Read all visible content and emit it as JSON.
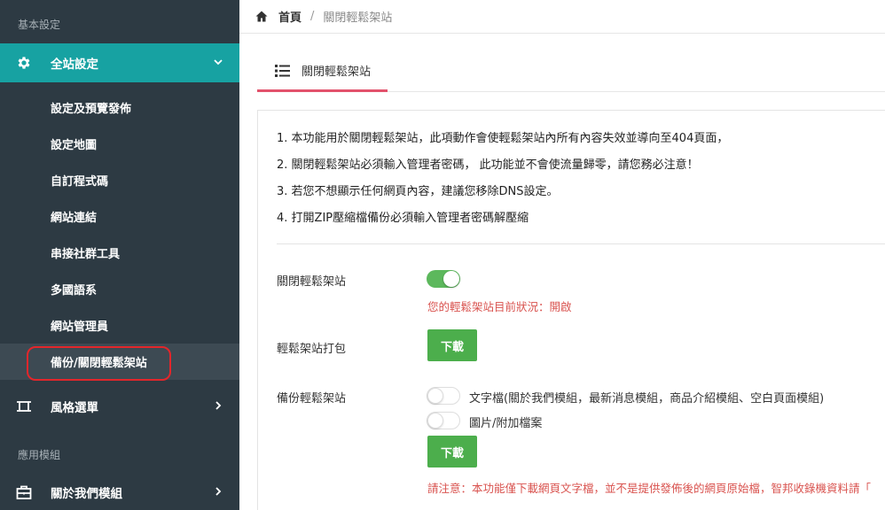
{
  "sidebar": {
    "section_basic": "基本設定",
    "group_site": {
      "label": "全站設定",
      "icon": "gear-icon"
    },
    "sub_items": [
      "設定及預覽發佈",
      "設定地圖",
      "自訂程式碼",
      "網站連結",
      "串接社群工具",
      "多國語系",
      "網站管理員",
      "備份/關閉輕鬆架站"
    ],
    "group_style": {
      "label": "風格選單",
      "icon": "crop-frame-icon"
    },
    "section_modules": "應用模組",
    "group_about": {
      "label": "關於我們模組",
      "icon": "briefcase-icon"
    }
  },
  "breadcrumb": {
    "home": "首頁",
    "separator": "/",
    "current": "關閉輕鬆架站"
  },
  "tab": {
    "label": "關閉輕鬆架站"
  },
  "notes": [
    "1. 本功能用於關閉輕鬆架站，此項動作會使輕鬆架站內所有內容失效並導向至404頁面，",
    "2. 關閉輕鬆架站必須輸入管理者密碼， 此功能並不會使流量歸零，請您務必注意！",
    "3. 若您不想顯示任何網頁內容，建議您移除DNS設定。",
    "4. 打開ZIP壓縮檔備份必須輸入管理者密碼解壓縮"
  ],
  "close_site": {
    "label": "關閉輕鬆架站",
    "toggle_on": true,
    "status": "您的輕鬆架站目前狀況：開啟"
  },
  "pack": {
    "label": "輕鬆架站打包",
    "button": "下載"
  },
  "backup": {
    "label": "備份輕鬆架站",
    "option_text": "文字檔(關於我們模組，最新消息模組，商品介紹模組、空白頁面模組)",
    "option_images": "圖片/附加檔案",
    "button": "下載",
    "warning": "請注意：本功能僅下載網頁文字檔，並不是提供發佈後的網頁原始檔，智邦收錄機資料請「"
  },
  "colors": {
    "sidebar_bg": "#2d3a43",
    "active_group": "#17a2a2",
    "accent_pink": "#e2526c",
    "green": "#4cae4c",
    "red_text": "#d9534f"
  }
}
